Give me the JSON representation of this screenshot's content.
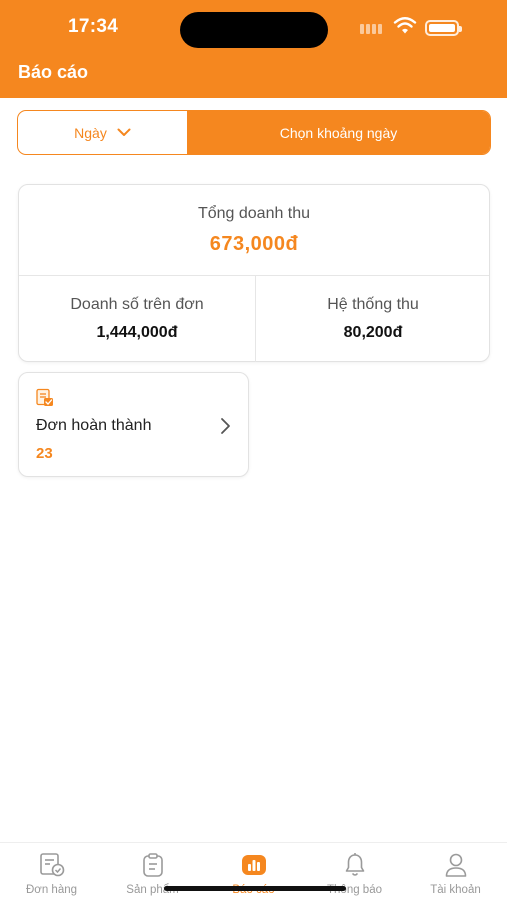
{
  "status_bar": {
    "time": "17:34"
  },
  "header": {
    "title": "Báo cáo"
  },
  "date_filter": {
    "day_label": "Ngày",
    "range_label": "Chọn khoảng ngày"
  },
  "summary": {
    "total_label": "Tổng doanh thu",
    "total_value": "673,000đ",
    "sales_label": "Doanh số trên đơn",
    "sales_value": "1,444,000đ",
    "system_label": "Hệ thống thu",
    "system_value": "80,200đ"
  },
  "orders_card": {
    "icon": "document-icon",
    "label": "Đơn hoàn thành",
    "count": "23"
  },
  "tabbar": {
    "active": "reports",
    "tabs": [
      {
        "id": "orders",
        "label": "Đơn hàng",
        "icon": "order-icon"
      },
      {
        "id": "products",
        "label": "Sản phẩm",
        "icon": "clipboard-icon"
      },
      {
        "id": "reports",
        "label": "Báo cáo",
        "icon": "chart-icon"
      },
      {
        "id": "notifications",
        "label": "Thông báo",
        "icon": "bell-icon"
      },
      {
        "id": "account",
        "label": "Tài khoản",
        "icon": "user-icon"
      }
    ]
  },
  "colors": {
    "accent": "#f5871f",
    "muted": "#999999"
  }
}
